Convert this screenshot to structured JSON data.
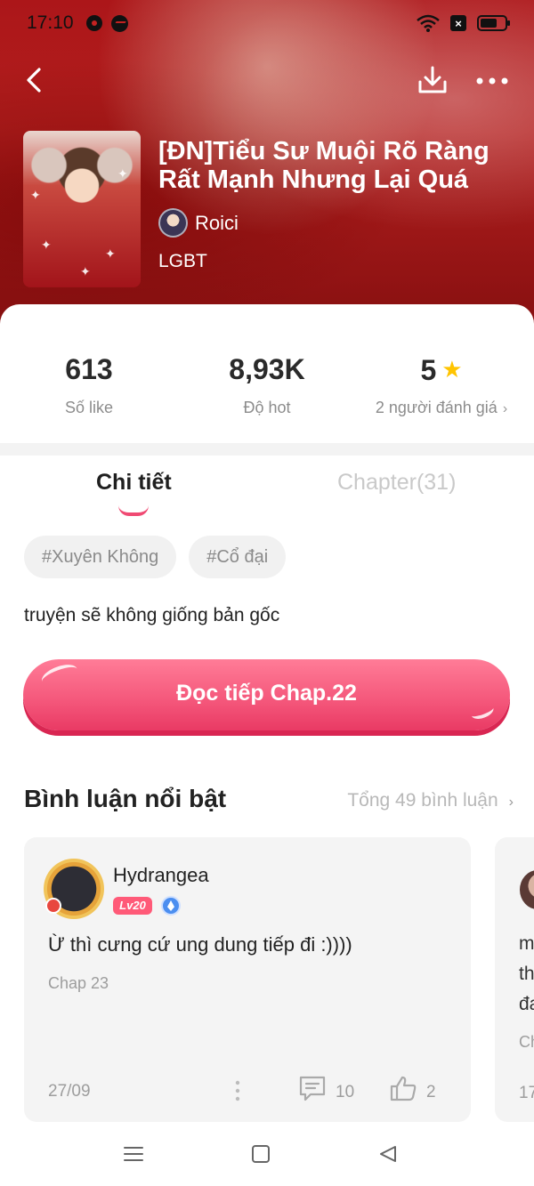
{
  "status_bar": {
    "time": "17:10",
    "left_icons": [
      "gear-icon",
      "messenger-icon"
    ],
    "right_icons": [
      "wifi-icon",
      "sim-icon",
      "battery-icon"
    ],
    "battery_level": 0.7
  },
  "header": {
    "back_icon": "chevron-left-icon",
    "download_icon": "download-icon",
    "more_icon": "more-icon"
  },
  "story": {
    "title": "[ĐN]Tiểu Sư Muội Rõ Ràng Rất Mạnh Nhưng Lại Quá",
    "author": "Roici",
    "genre": "LGBT",
    "description": "truyện sẽ không giống bản gốc"
  },
  "stats": {
    "likes_value": "613",
    "likes_label": "Số like",
    "hot_value": "8,93K",
    "hot_label": "Độ hot",
    "rating_value": "5",
    "rating_label": "2 người đánh giá"
  },
  "tabs": {
    "details": "Chi tiết",
    "chapters": "Chapter(31)"
  },
  "tags": [
    "#Xuyên Không",
    "#Cổ đại"
  ],
  "read_button": "Đọc tiếp Chap.22",
  "comments_section": {
    "title": "Bình luận nổi bật",
    "total": "Tổng 49 bình luận"
  },
  "comment": {
    "user": "Hydrangea",
    "level": "Lv20",
    "text": "Ừ thì cưng cứ ung dung tiếp đi :))))",
    "chapter": "Chap 23",
    "date": "27/09",
    "reply_count": "10",
    "like_count": "2"
  },
  "comment_peek": {
    "line1": "m",
    "line2": "th",
    "line3": "đa",
    "chapter": "Ch",
    "date": "17"
  },
  "colors": {
    "accent": "#f04a73",
    "button": "#f4567a",
    "star": "#ffc400",
    "hero": "#c42221"
  }
}
